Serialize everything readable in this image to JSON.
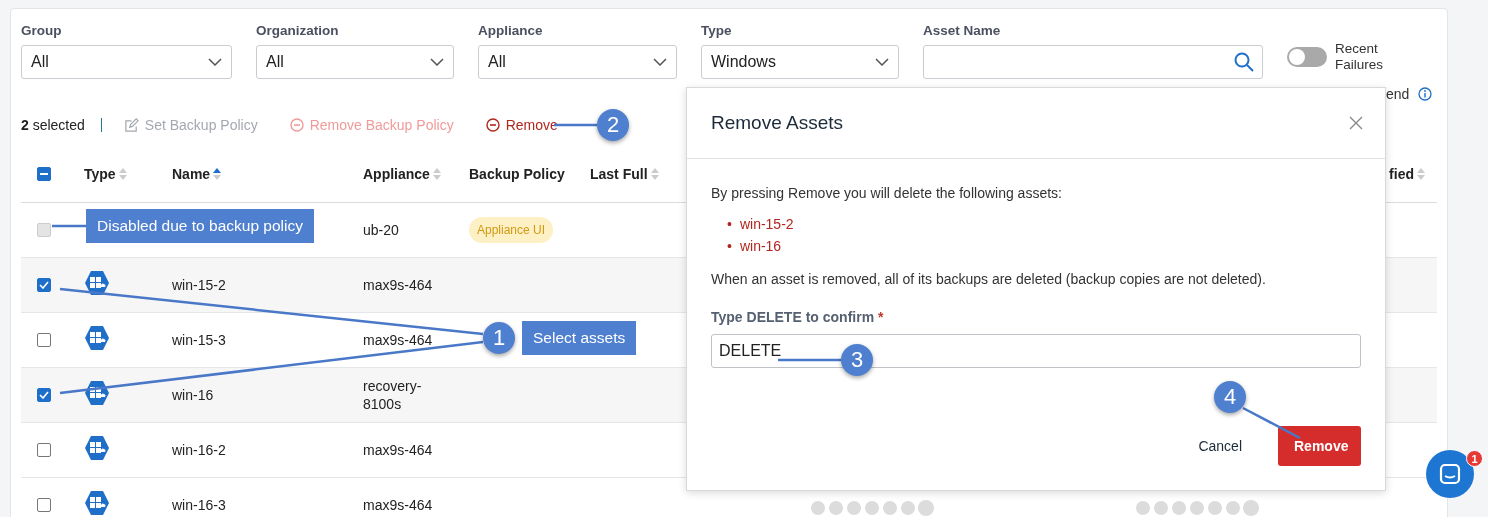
{
  "filters": [
    {
      "label": "Group",
      "value": "All"
    },
    {
      "label": "Organization",
      "value": "All"
    },
    {
      "label": "Appliance",
      "value": "All"
    },
    {
      "label": "Type",
      "value": "Windows"
    }
  ],
  "asset_search": {
    "label": "Asset Name"
  },
  "recent_failures": {
    "label": "Recent Failures",
    "on": false
  },
  "legend": {
    "label": "end"
  },
  "selection": {
    "summary": "**2** selected"
  },
  "actions": [
    {
      "kind": "edit",
      "label": "Set Backup Policy",
      "disabled": true
    },
    {
      "kind": "remove-policy",
      "label": "Remove Backup Policy",
      "disabled": true
    },
    {
      "kind": "remove",
      "label": "Remove",
      "disabled": false
    }
  ],
  "table": {
    "select_all": {
      "indeterminate": true
    },
    "columns": [
      {
        "label": "Type",
        "sortable": true
      },
      {
        "label": "Name",
        "sortable": true,
        "sorted": true
      },
      {
        "label": "Appliance",
        "sortable": true
      },
      {
        "label": "Backup Policy",
        "sortable": false
      },
      {
        "label": "Last Full",
        "sortable": true
      },
      {
        "label": "fied",
        "sortable": true
      }
    ],
    "rows": [
      {
        "checked": false,
        "disabled": true,
        "appliance": "ub-20",
        "backup_policy": "Appliance UI"
      },
      {
        "checked": true,
        "disabled": false,
        "kind": "windows",
        "name": "win-15-2",
        "appliance": "max9s-464"
      },
      {
        "checked": false,
        "disabled": false,
        "kind": "windows",
        "name": "win-15-3",
        "appliance": "max9s-464"
      },
      {
        "checked": true,
        "disabled": false,
        "kind": "windows",
        "name": "win-16",
        "appliance": "recovery-8100s"
      },
      {
        "checked": false,
        "disabled": false,
        "kind": "windows",
        "name": "win-16-2",
        "appliance": "max9s-464"
      },
      {
        "checked": false,
        "disabled": false,
        "kind": "windows",
        "name": "win-16-3",
        "appliance": "max9s-464"
      }
    ]
  },
  "modal": {
    "title": "Remove Assets",
    "intro": "By pressing Remove you will delete the following assets:",
    "assets": [
      {
        "marker": "•",
        "name": "win-15-2"
      },
      {
        "marker": "•",
        "name": "win-16"
      }
    ],
    "note": "When an asset is removed, all of its backups are deleted (backup copies are not deleted).",
    "confirm_label": "Type DELETE to confirm",
    "required_mark": "*",
    "confirm_value": "DELETE",
    "buttons": [
      {
        "kind": "secondary",
        "label": "Cancel"
      },
      {
        "kind": "danger",
        "label": "Remove"
      }
    ]
  },
  "chat": {
    "unread": "1"
  },
  "callouts": [
    {
      "number": "2"
    },
    {
      "text": "Disabled due to backup policy"
    },
    {
      "number": "1",
      "text": "Select assets"
    },
    {
      "number": "3"
    },
    {
      "number": "4"
    }
  ]
}
